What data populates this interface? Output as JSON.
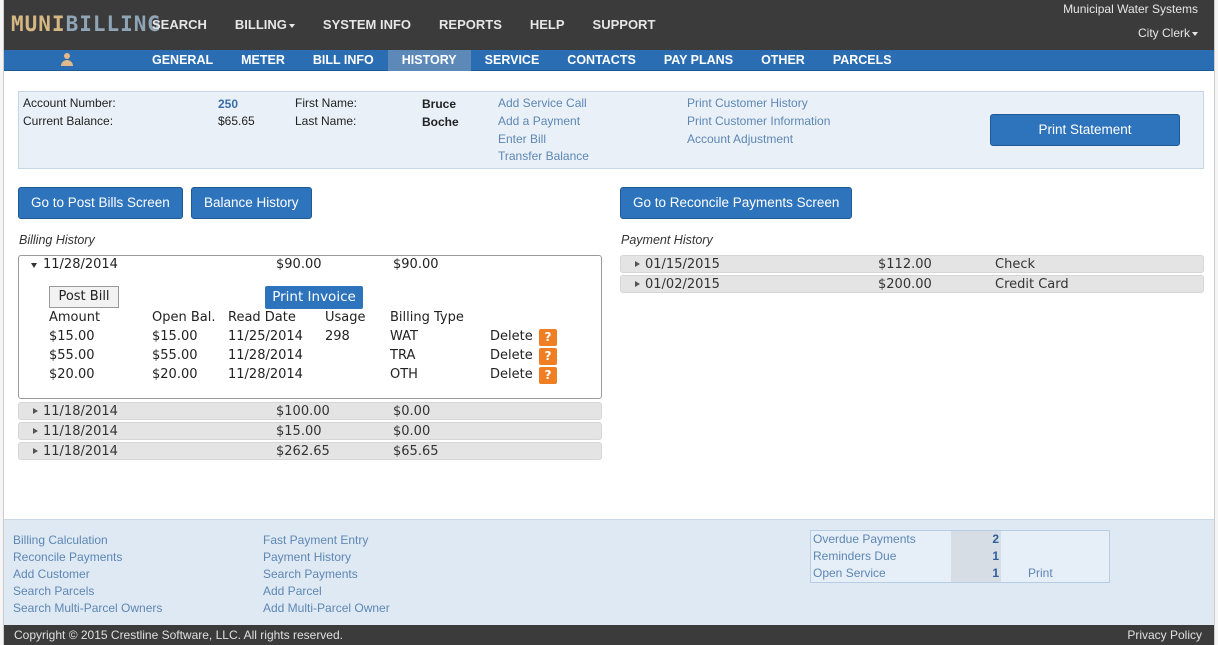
{
  "brand": {
    "part1": "MUNI",
    "part2": "BILLING"
  },
  "top_nav": [
    "SEARCH",
    "BILLING",
    "SYSTEM INFO",
    "REPORTS",
    "HELP",
    "SUPPORT"
  ],
  "org_name": "Municipal Water Systems",
  "user_menu": "City Clerk",
  "tabs": [
    "GENERAL",
    "METER",
    "BILL INFO",
    "HISTORY",
    "SERVICE",
    "CONTACTS",
    "PAY PLANS",
    "OTHER",
    "PARCELS"
  ],
  "active_tab": "HISTORY",
  "account": {
    "account_number_label": "Account Number:",
    "account_number": "250",
    "balance_label": "Current Balance:",
    "balance": "$65.65",
    "first_name_label": "First Name:",
    "first_name": "Bruce",
    "last_name_label": "Last Name:",
    "last_name": "Boche",
    "links_col1": [
      "Add Service Call",
      "Add a Payment",
      "Enter Bill",
      "Transfer Balance"
    ],
    "links_col2": [
      "Print Customer History",
      "Print Customer Information",
      "Account Adjustment"
    ],
    "print_statement": "Print Statement"
  },
  "buttons": {
    "post_bills": "Go to Post Bills Screen",
    "balance_history": "Balance History",
    "reconcile": "Go to Reconcile Payments Screen"
  },
  "billing_history": {
    "title": "Billing History",
    "expanded": {
      "date": "11/28/2014",
      "amount": "$90.00",
      "open": "$90.00",
      "post_bill": "Post Bill",
      "print_invoice": "Print Invoice",
      "headers": [
        "Amount",
        "Open Bal.",
        "Read Date",
        "Usage",
        "Billing Type"
      ],
      "rows": [
        {
          "amount": "$15.00",
          "open": "$15.00",
          "read_date": "11/25/2014",
          "usage": "298",
          "type": "WAT",
          "delete": "Delete"
        },
        {
          "amount": "$55.00",
          "open": "$55.00",
          "read_date": "11/28/2014",
          "usage": "",
          "type": "TRA",
          "delete": "Delete"
        },
        {
          "amount": "$20.00",
          "open": "$20.00",
          "read_date": "11/28/2014",
          "usage": "",
          "type": "OTH",
          "delete": "Delete"
        }
      ],
      "help_glyph": "?"
    },
    "collapsed": [
      {
        "date": "11/18/2014",
        "amount": "$100.00",
        "open": "$0.00"
      },
      {
        "date": "11/18/2014",
        "amount": "$15.00",
        "open": "$0.00"
      },
      {
        "date": "11/18/2014",
        "amount": "$262.65",
        "open": "$65.65"
      }
    ]
  },
  "payment_history": {
    "title": "Payment History",
    "rows": [
      {
        "date": "01/15/2015",
        "amount": "$112.00",
        "method": "Check"
      },
      {
        "date": "01/02/2015",
        "amount": "$200.00",
        "method": "Credit Card"
      }
    ]
  },
  "footer": {
    "col1": [
      "Billing Calculation",
      "Reconcile Payments",
      "Add Customer",
      "Search Parcels",
      "Search Multi-Parcel Owners"
    ],
    "col2": [
      "Fast Payment Entry",
      "Payment History",
      "Search Payments",
      "Add Parcel",
      "Add Multi-Parcel Owner"
    ],
    "stats": [
      {
        "label": "Overdue Payments",
        "value": "2",
        "action": ""
      },
      {
        "label": "Reminders Due",
        "value": "1",
        "action": ""
      },
      {
        "label": "Open Service",
        "value": "1",
        "action": "Print"
      }
    ]
  },
  "copyright": "Copyright © 2015 Crestline Software, LLC. All rights reserved.",
  "privacy": "Privacy Policy",
  "colors": {
    "topbar": "#3b3b3b",
    "tabbar": "#2a6db3",
    "button": "#2d74bc",
    "help": "#f07f24",
    "link": "#5d87b3"
  }
}
